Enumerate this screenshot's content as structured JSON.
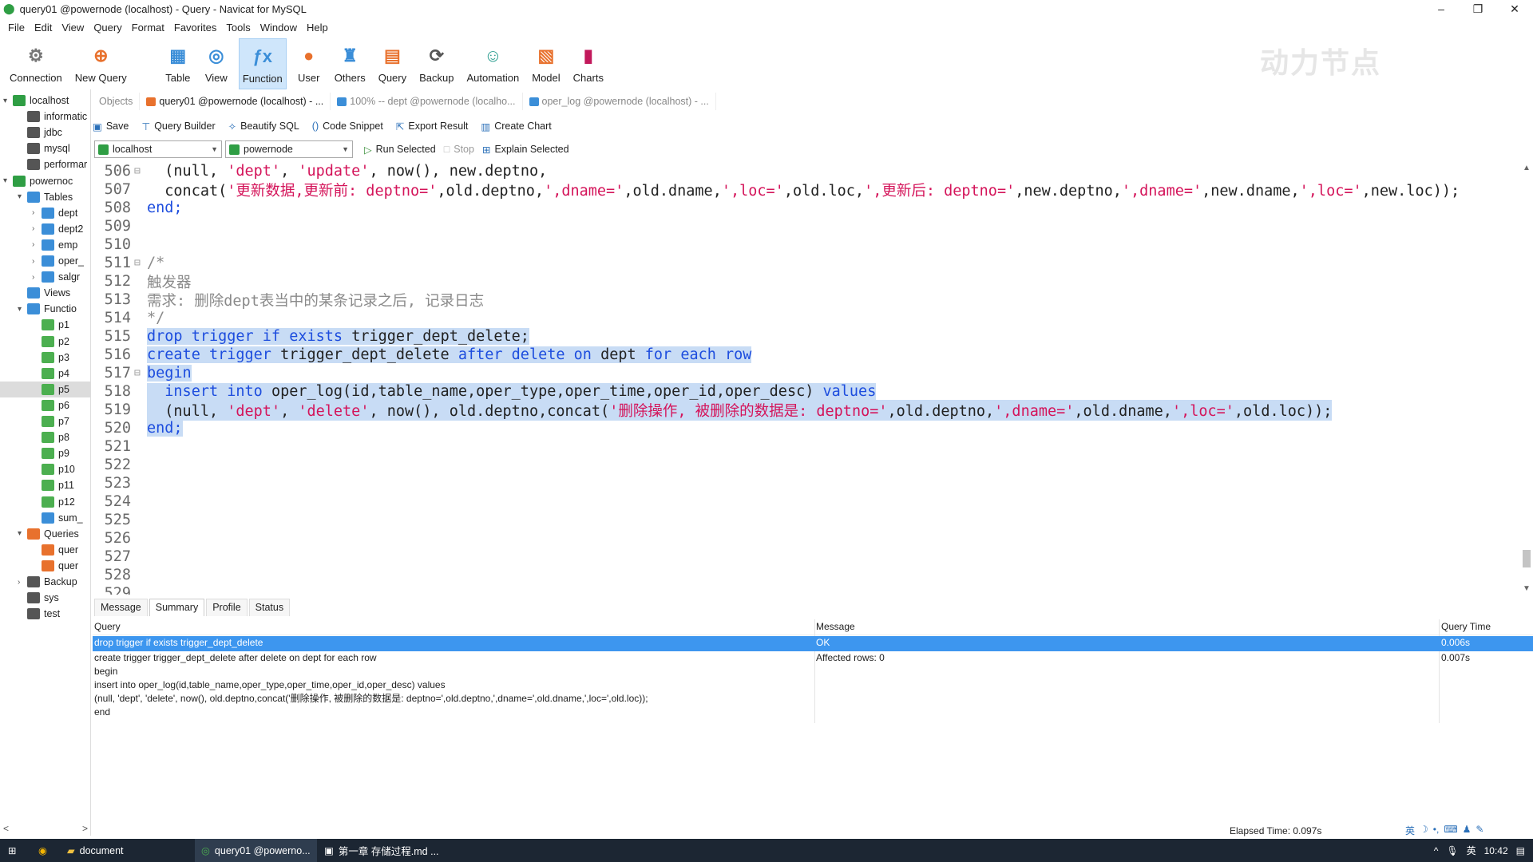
{
  "window": {
    "title": "query01 @powernode (localhost) - Query - Navicat for MySQL",
    "controls": [
      "–",
      "❐",
      "✕"
    ]
  },
  "menu": [
    "File",
    "Edit",
    "View",
    "Query",
    "Format",
    "Favorites",
    "Tools",
    "Window",
    "Help"
  ],
  "toolbar": [
    {
      "label": "Connection",
      "icon": "connection-icon"
    },
    {
      "label": "New Query",
      "icon": "new-query-icon"
    },
    {
      "label": "Table",
      "icon": "table-icon"
    },
    {
      "label": "View",
      "icon": "view-icon"
    },
    {
      "label": "Function",
      "icon": "function-icon"
    },
    {
      "label": "User",
      "icon": "user-icon"
    },
    {
      "label": "Others",
      "icon": "others-icon"
    },
    {
      "label": "Query",
      "icon": "query-icon"
    },
    {
      "label": "Backup",
      "icon": "backup-icon"
    },
    {
      "label": "Automation",
      "icon": "automation-icon"
    },
    {
      "label": "Model",
      "icon": "model-icon"
    },
    {
      "label": "Charts",
      "icon": "charts-icon"
    }
  ],
  "watermark": "动力节点",
  "sidebar": {
    "items": [
      {
        "label": "localhost",
        "arrow": "v",
        "color": "#2f9e44"
      },
      {
        "label": "informatic",
        "arrow": "",
        "color": "#555"
      },
      {
        "label": "jdbc",
        "arrow": "",
        "color": "#555"
      },
      {
        "label": "mysql",
        "arrow": "",
        "color": "#555"
      },
      {
        "label": "performar",
        "arrow": "",
        "color": "#555"
      },
      {
        "label": "powernoc",
        "arrow": "v",
        "color": "#2f9e44"
      },
      {
        "label": "Tables",
        "arrow": "v",
        "color": "#3b8ed8"
      },
      {
        "label": "dept",
        "arrow": ">",
        "color": "#3b8ed8"
      },
      {
        "label": "dept2",
        "arrow": ">",
        "color": "#3b8ed8"
      },
      {
        "label": "emp",
        "arrow": ">",
        "color": "#3b8ed8"
      },
      {
        "label": "oper_",
        "arrow": ">",
        "color": "#3b8ed8"
      },
      {
        "label": "salgr",
        "arrow": ">",
        "color": "#3b8ed8"
      },
      {
        "label": "Views",
        "arrow": "",
        "color": "#3b8ed8"
      },
      {
        "label": "Functio",
        "arrow": "v",
        "color": "#3b8ed8"
      },
      {
        "label": "p1",
        "arrow": "",
        "color": "#4caf50"
      },
      {
        "label": "p2",
        "arrow": "",
        "color": "#4caf50"
      },
      {
        "label": "p3",
        "arrow": "",
        "color": "#4caf50"
      },
      {
        "label": "p4",
        "arrow": "",
        "color": "#4caf50"
      },
      {
        "label": "p5",
        "arrow": "",
        "color": "#4caf50"
      },
      {
        "label": "p6",
        "arrow": "",
        "color": "#4caf50"
      },
      {
        "label": "p7",
        "arrow": "",
        "color": "#4caf50"
      },
      {
        "label": "p8",
        "arrow": "",
        "color": "#4caf50"
      },
      {
        "label": "p9",
        "arrow": "",
        "color": "#4caf50"
      },
      {
        "label": "p10",
        "arrow": "",
        "color": "#4caf50"
      },
      {
        "label": "p11",
        "arrow": "",
        "color": "#4caf50"
      },
      {
        "label": "p12",
        "arrow": "",
        "color": "#4caf50"
      },
      {
        "label": "sum_",
        "arrow": "",
        "color": "#3b8ed8"
      },
      {
        "label": "Queries",
        "arrow": "v",
        "color": "#e8712d"
      },
      {
        "label": "quer",
        "arrow": "",
        "color": "#e8712d"
      },
      {
        "label": "quer",
        "arrow": "",
        "color": "#e8712d"
      },
      {
        "label": "Backup",
        "arrow": ">",
        "color": "#555"
      },
      {
        "label": "sys",
        "arrow": "",
        "color": "#555"
      },
      {
        "label": "test",
        "arrow": "",
        "color": "#555"
      }
    ],
    "selected_index": 18,
    "scroll_left": "<",
    "scroll_right": ">"
  },
  "tabs": [
    {
      "label": "Objects",
      "active": false
    },
    {
      "label": "query01 @powernode (localhost) - ...",
      "active": true
    },
    {
      "label": "100% -- dept @powernode (localho...",
      "active": false
    },
    {
      "label": "oper_log @powernode (localhost) - ...",
      "active": false
    }
  ],
  "query_toolbar": {
    "save": "Save",
    "query_builder": "Query Builder",
    "beautify": "Beautify SQL",
    "snippet": "Code Snippet",
    "export": "Export Result",
    "chart": "Create Chart"
  },
  "connection_bar": {
    "connection": "localhost",
    "database": "powernode",
    "run": "Run Selected",
    "stop": "Stop",
    "explain": "Explain Selected"
  },
  "editor": {
    "highlight_color": "#c8dcf5",
    "lines": [
      {
        "num": "506",
        "fold": "⊟",
        "hl": false,
        "tokens": [
          {
            "t": "  (null, ",
            "c": ""
          },
          {
            "t": "'dept'",
            "c": "str"
          },
          {
            "t": ", ",
            "c": ""
          },
          {
            "t": "'update'",
            "c": "str"
          },
          {
            "t": ", now(), new.deptno,",
            "c": ""
          }
        ]
      },
      {
        "num": "507",
        "fold": "",
        "hl": false,
        "tokens": [
          {
            "t": "  concat(",
            "c": ""
          },
          {
            "t": "'更新数据,更新前: deptno='",
            "c": "str"
          },
          {
            "t": ",old.deptno,",
            "c": ""
          },
          {
            "t": "',dname='",
            "c": "str"
          },
          {
            "t": ",old.dname,",
            "c": ""
          },
          {
            "t": "',loc='",
            "c": "str"
          },
          {
            "t": ",old.loc,",
            "c": ""
          },
          {
            "t": "',更新后: deptno='",
            "c": "str"
          },
          {
            "t": ",new.deptno,",
            "c": ""
          },
          {
            "t": "',dname='",
            "c": "str"
          },
          {
            "t": ",new.dname,",
            "c": ""
          },
          {
            "t": "',loc='",
            "c": "str"
          },
          {
            "t": ",new.loc));",
            "c": ""
          }
        ]
      },
      {
        "num": "508",
        "fold": "",
        "hl": false,
        "tokens": [
          {
            "t": "end;",
            "c": "kw"
          }
        ]
      },
      {
        "num": "509",
        "fold": "",
        "hl": false,
        "tokens": []
      },
      {
        "num": "510",
        "fold": "",
        "hl": false,
        "tokens": []
      },
      {
        "num": "511",
        "fold": "⊟",
        "hl": false,
        "tokens": [
          {
            "t": "/*",
            "c": "cmt"
          }
        ]
      },
      {
        "num": "512",
        "fold": "",
        "hl": false,
        "tokens": [
          {
            "t": "触发器",
            "c": "cmt"
          }
        ]
      },
      {
        "num": "513",
        "fold": "",
        "hl": false,
        "tokens": [
          {
            "t": "需求: 删除dept表当中的某条记录之后, 记录日志",
            "c": "cmt"
          }
        ]
      },
      {
        "num": "514",
        "fold": "",
        "hl": false,
        "tokens": [
          {
            "t": "*/",
            "c": "cmt"
          }
        ]
      },
      {
        "num": "515",
        "fold": "",
        "hl": true,
        "tokens": [
          {
            "t": "drop trigger if exists ",
            "c": "kw"
          },
          {
            "t": "trigger_dept_delete;",
            "c": ""
          }
        ]
      },
      {
        "num": "516",
        "fold": "",
        "hl": true,
        "tokens": [
          {
            "t": "create trigger ",
            "c": "kw"
          },
          {
            "t": "trigger_dept_delete ",
            "c": ""
          },
          {
            "t": "after delete on ",
            "c": "kw"
          },
          {
            "t": "dept ",
            "c": ""
          },
          {
            "t": "for each row",
            "c": "kw"
          }
        ]
      },
      {
        "num": "517",
        "fold": "⊟",
        "hl": true,
        "tokens": [
          {
            "t": "begin",
            "c": "kw"
          }
        ]
      },
      {
        "num": "518",
        "fold": "",
        "hl": true,
        "tokens": [
          {
            "t": "  insert into ",
            "c": "kw"
          },
          {
            "t": "oper_log(id,table_name,oper_type,oper_time,oper_id,oper_desc) ",
            "c": ""
          },
          {
            "t": "values",
            "c": "kw"
          }
        ]
      },
      {
        "num": "519",
        "fold": "",
        "hl": true,
        "tokens": [
          {
            "t": "  (null, ",
            "c": ""
          },
          {
            "t": "'dept'",
            "c": "str"
          },
          {
            "t": ", ",
            "c": ""
          },
          {
            "t": "'delete'",
            "c": "str"
          },
          {
            "t": ", now(), old.deptno,concat(",
            "c": ""
          },
          {
            "t": "'删除操作, 被删除的数据是: deptno='",
            "c": "str"
          },
          {
            "t": ",old.deptno,",
            "c": ""
          },
          {
            "t": "',dname='",
            "c": "str"
          },
          {
            "t": ",old.dname,",
            "c": ""
          },
          {
            "t": "',loc='",
            "c": "str"
          },
          {
            "t": ",old.loc));",
            "c": ""
          }
        ]
      },
      {
        "num": "520",
        "fold": "",
        "hl": true,
        "tokens": [
          {
            "t": "end;",
            "c": "kw"
          }
        ]
      },
      {
        "num": "521",
        "fold": "",
        "hl": false,
        "tokens": []
      },
      {
        "num": "522",
        "fold": "",
        "hl": false,
        "tokens": []
      },
      {
        "num": "523",
        "fold": "",
        "hl": false,
        "tokens": []
      },
      {
        "num": "524",
        "fold": "",
        "hl": false,
        "tokens": []
      },
      {
        "num": "525",
        "fold": "",
        "hl": false,
        "tokens": []
      },
      {
        "num": "526",
        "fold": "",
        "hl": false,
        "tokens": []
      },
      {
        "num": "527",
        "fold": "",
        "hl": false,
        "tokens": []
      },
      {
        "num": "528",
        "fold": "",
        "hl": false,
        "tokens": []
      },
      {
        "num": "529",
        "fold": "",
        "hl": false,
        "tokens": []
      }
    ]
  },
  "result_tabs": [
    "Message",
    "Summary",
    "Profile",
    "Status"
  ],
  "result_active_tab": 1,
  "results": {
    "headers": [
      "Query",
      "Message",
      "Query Time"
    ],
    "rows": [
      {
        "query": "drop trigger if exists trigger_dept_delete",
        "message": "OK",
        "time": "0.006s",
        "selected": true
      },
      {
        "query": "create trigger trigger_dept_delete after delete on dept for each row\nbegin\ninsert into oper_log(id,table_name,oper_type,oper_time,oper_id,oper_desc) values\n(null, 'dept', 'delete', now(), old.deptno,concat('删除操作, 被删除的数据是: deptno=',old.deptno,',dname=',old.dname,',loc=',old.loc));\nend",
        "message": "Affected rows: 0",
        "time": "0.007s",
        "selected": false
      }
    ],
    "selected_color": "#3d96ef"
  },
  "status": {
    "elapsed": "Elapsed Time: 0.097s",
    "ime": [
      "英",
      "☽",
      "•,",
      "⌨",
      "♟",
      "✎"
    ]
  },
  "taskbar": {
    "items": [
      {
        "label": "document",
        "icon": "folder-icon"
      },
      {
        "label": "query01 @powerno...",
        "icon": "navicat-icon"
      },
      {
        "label": "第一章 存储过程.md ...",
        "icon": "typora-icon"
      }
    ],
    "tray_lang": "英",
    "clock": "10:42"
  }
}
